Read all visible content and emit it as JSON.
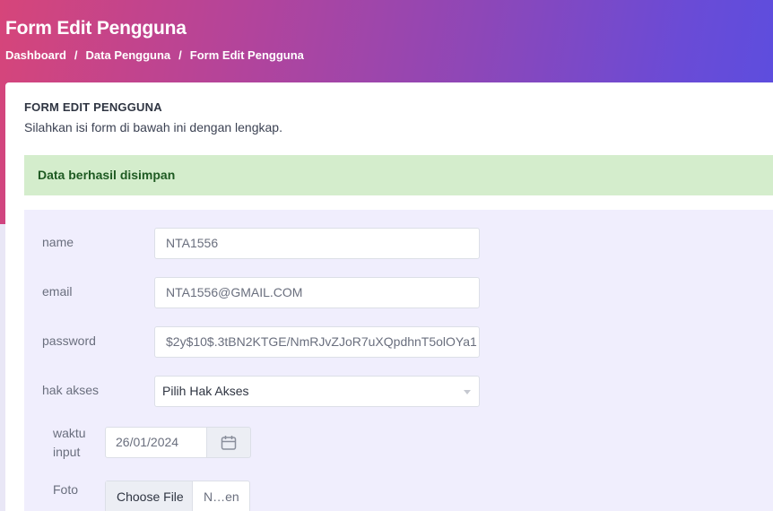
{
  "header": {
    "title": "Form Edit Pengguna",
    "breadcrumb": [
      "Dashboard",
      "Data Pengguna",
      "Form Edit Pengguna"
    ],
    "breadcrumb_separator": "/"
  },
  "card": {
    "title": "FORM EDIT PENGGUNA",
    "subtitle": "Silahkan isi form di bawah ini dengan lengkap."
  },
  "alert": {
    "message": "Data berhasil disimpan"
  },
  "form": {
    "name": {
      "label": "name",
      "value": "NTA1556"
    },
    "email": {
      "label": "email",
      "value": "NTA1556@GMAIL.COM"
    },
    "password": {
      "label": "password",
      "value": "$2y$10$.3tBN2KTGE/NmRJvZJoR7uXQpdhnT5olOYa1"
    },
    "hak_akses": {
      "label": "hak akses",
      "selected": "Pilih Hak Akses"
    },
    "waktu_input": {
      "label_line1": "waktu",
      "label_line2": "input",
      "value": "26/01/2024",
      "icon": "calendar-icon"
    },
    "foto": {
      "label": "Foto",
      "button_label": "Choose File",
      "file_name": "N…en"
    }
  },
  "colors": {
    "gradient_start": "#d6457a",
    "gradient_end": "#5a4ee0",
    "alert_bg": "#d4edcc",
    "alert_text": "#1e5a22",
    "form_bg": "#f0eefd"
  }
}
